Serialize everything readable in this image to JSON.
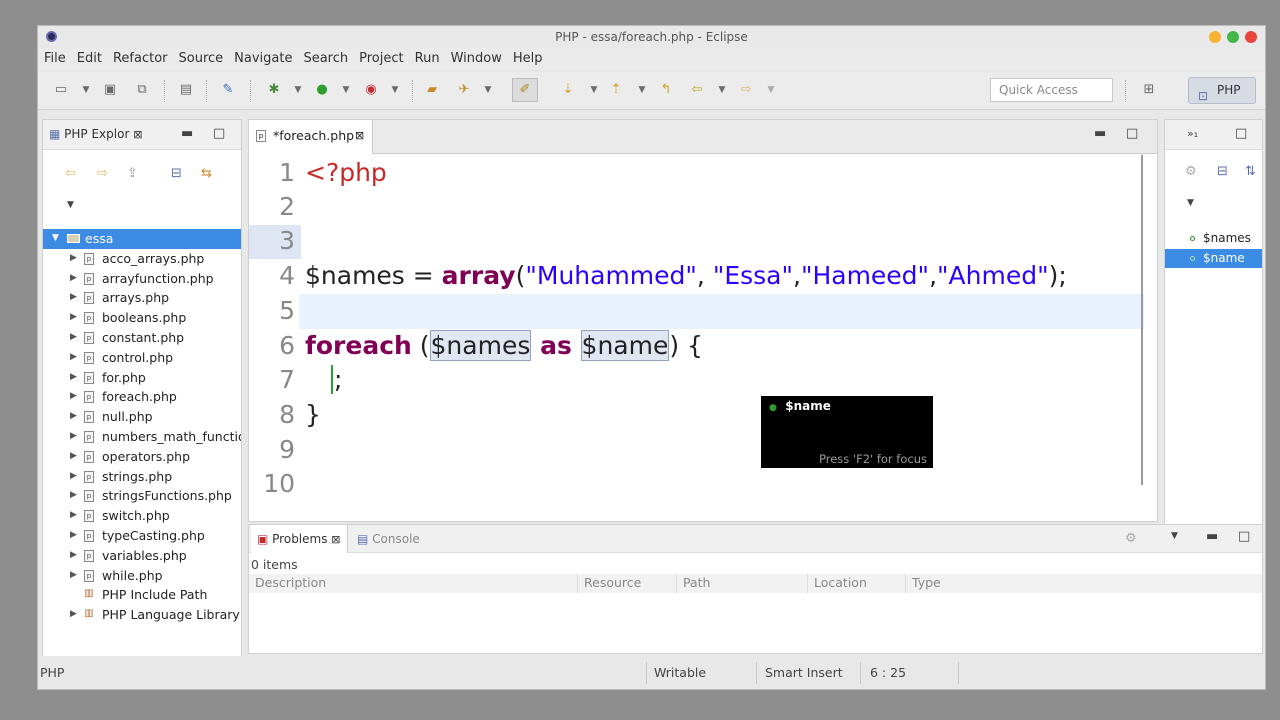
{
  "window": {
    "title": "PHP - essa/foreach.php - Eclipse"
  },
  "menu": [
    "File",
    "Edit",
    "Refactor",
    "Source",
    "Navigate",
    "Search",
    "Project",
    "Run",
    "Window",
    "Help"
  ],
  "toolbar": {
    "quick_access_placeholder": "Quick Access",
    "perspective_label": "PHP"
  },
  "explorer": {
    "tab_label": "PHP Explor",
    "project": "essa",
    "files": [
      "acco_arrays.php",
      "arrayfunction.php",
      "arrays.php",
      "booleans.php",
      "constant.php",
      "control.php",
      "for.php",
      "foreach.php",
      "null.php",
      "numbers_math_functions.php",
      "operators.php",
      "strings.php",
      "stringsFunctions.php",
      "switch.php",
      "typeCasting.php",
      "variables.php",
      "while.php"
    ],
    "extras": [
      "PHP Include Path",
      "PHP Language Library"
    ]
  },
  "editor": {
    "tab_label": "*foreach.php",
    "line_numbers": [
      "1",
      "2",
      "3",
      "4",
      "5",
      "6",
      "7",
      "8",
      "9",
      "10"
    ],
    "code": {
      "l1_open": "<?php",
      "l4_var": "$names = ",
      "l4_fn": "array",
      "l4_open": "(",
      "l4_s1": "\"Muhammed\"",
      "l4_c1": ", ",
      "l4_s2": "\"Essa\"",
      "l4_c2": ",",
      "l4_s3": "\"Hameed\"",
      "l4_c3": ",",
      "l4_s4": "\"Ahmed\"",
      "l4_end": ");",
      "l6_kw": "foreach",
      "l6_open": " (",
      "l6_var1": "$names",
      "l6_as": " as ",
      "l6_var2": "$name",
      "l6_end": ") {",
      "l7": ";",
      "l8": "}"
    },
    "popup": {
      "item": "$name",
      "hint": "Press 'F2' for focus"
    }
  },
  "outline": {
    "items": [
      "$names",
      "$name"
    ]
  },
  "problems": {
    "tab_label": "Problems",
    "console_label": "Console",
    "count": "0 items",
    "columns": [
      "Description",
      "Resource",
      "Path",
      "Location",
      "Type"
    ]
  },
  "status": {
    "left": "PHP",
    "writable": "Writable",
    "insert": "Smart Insert",
    "position": "6 : 25"
  }
}
